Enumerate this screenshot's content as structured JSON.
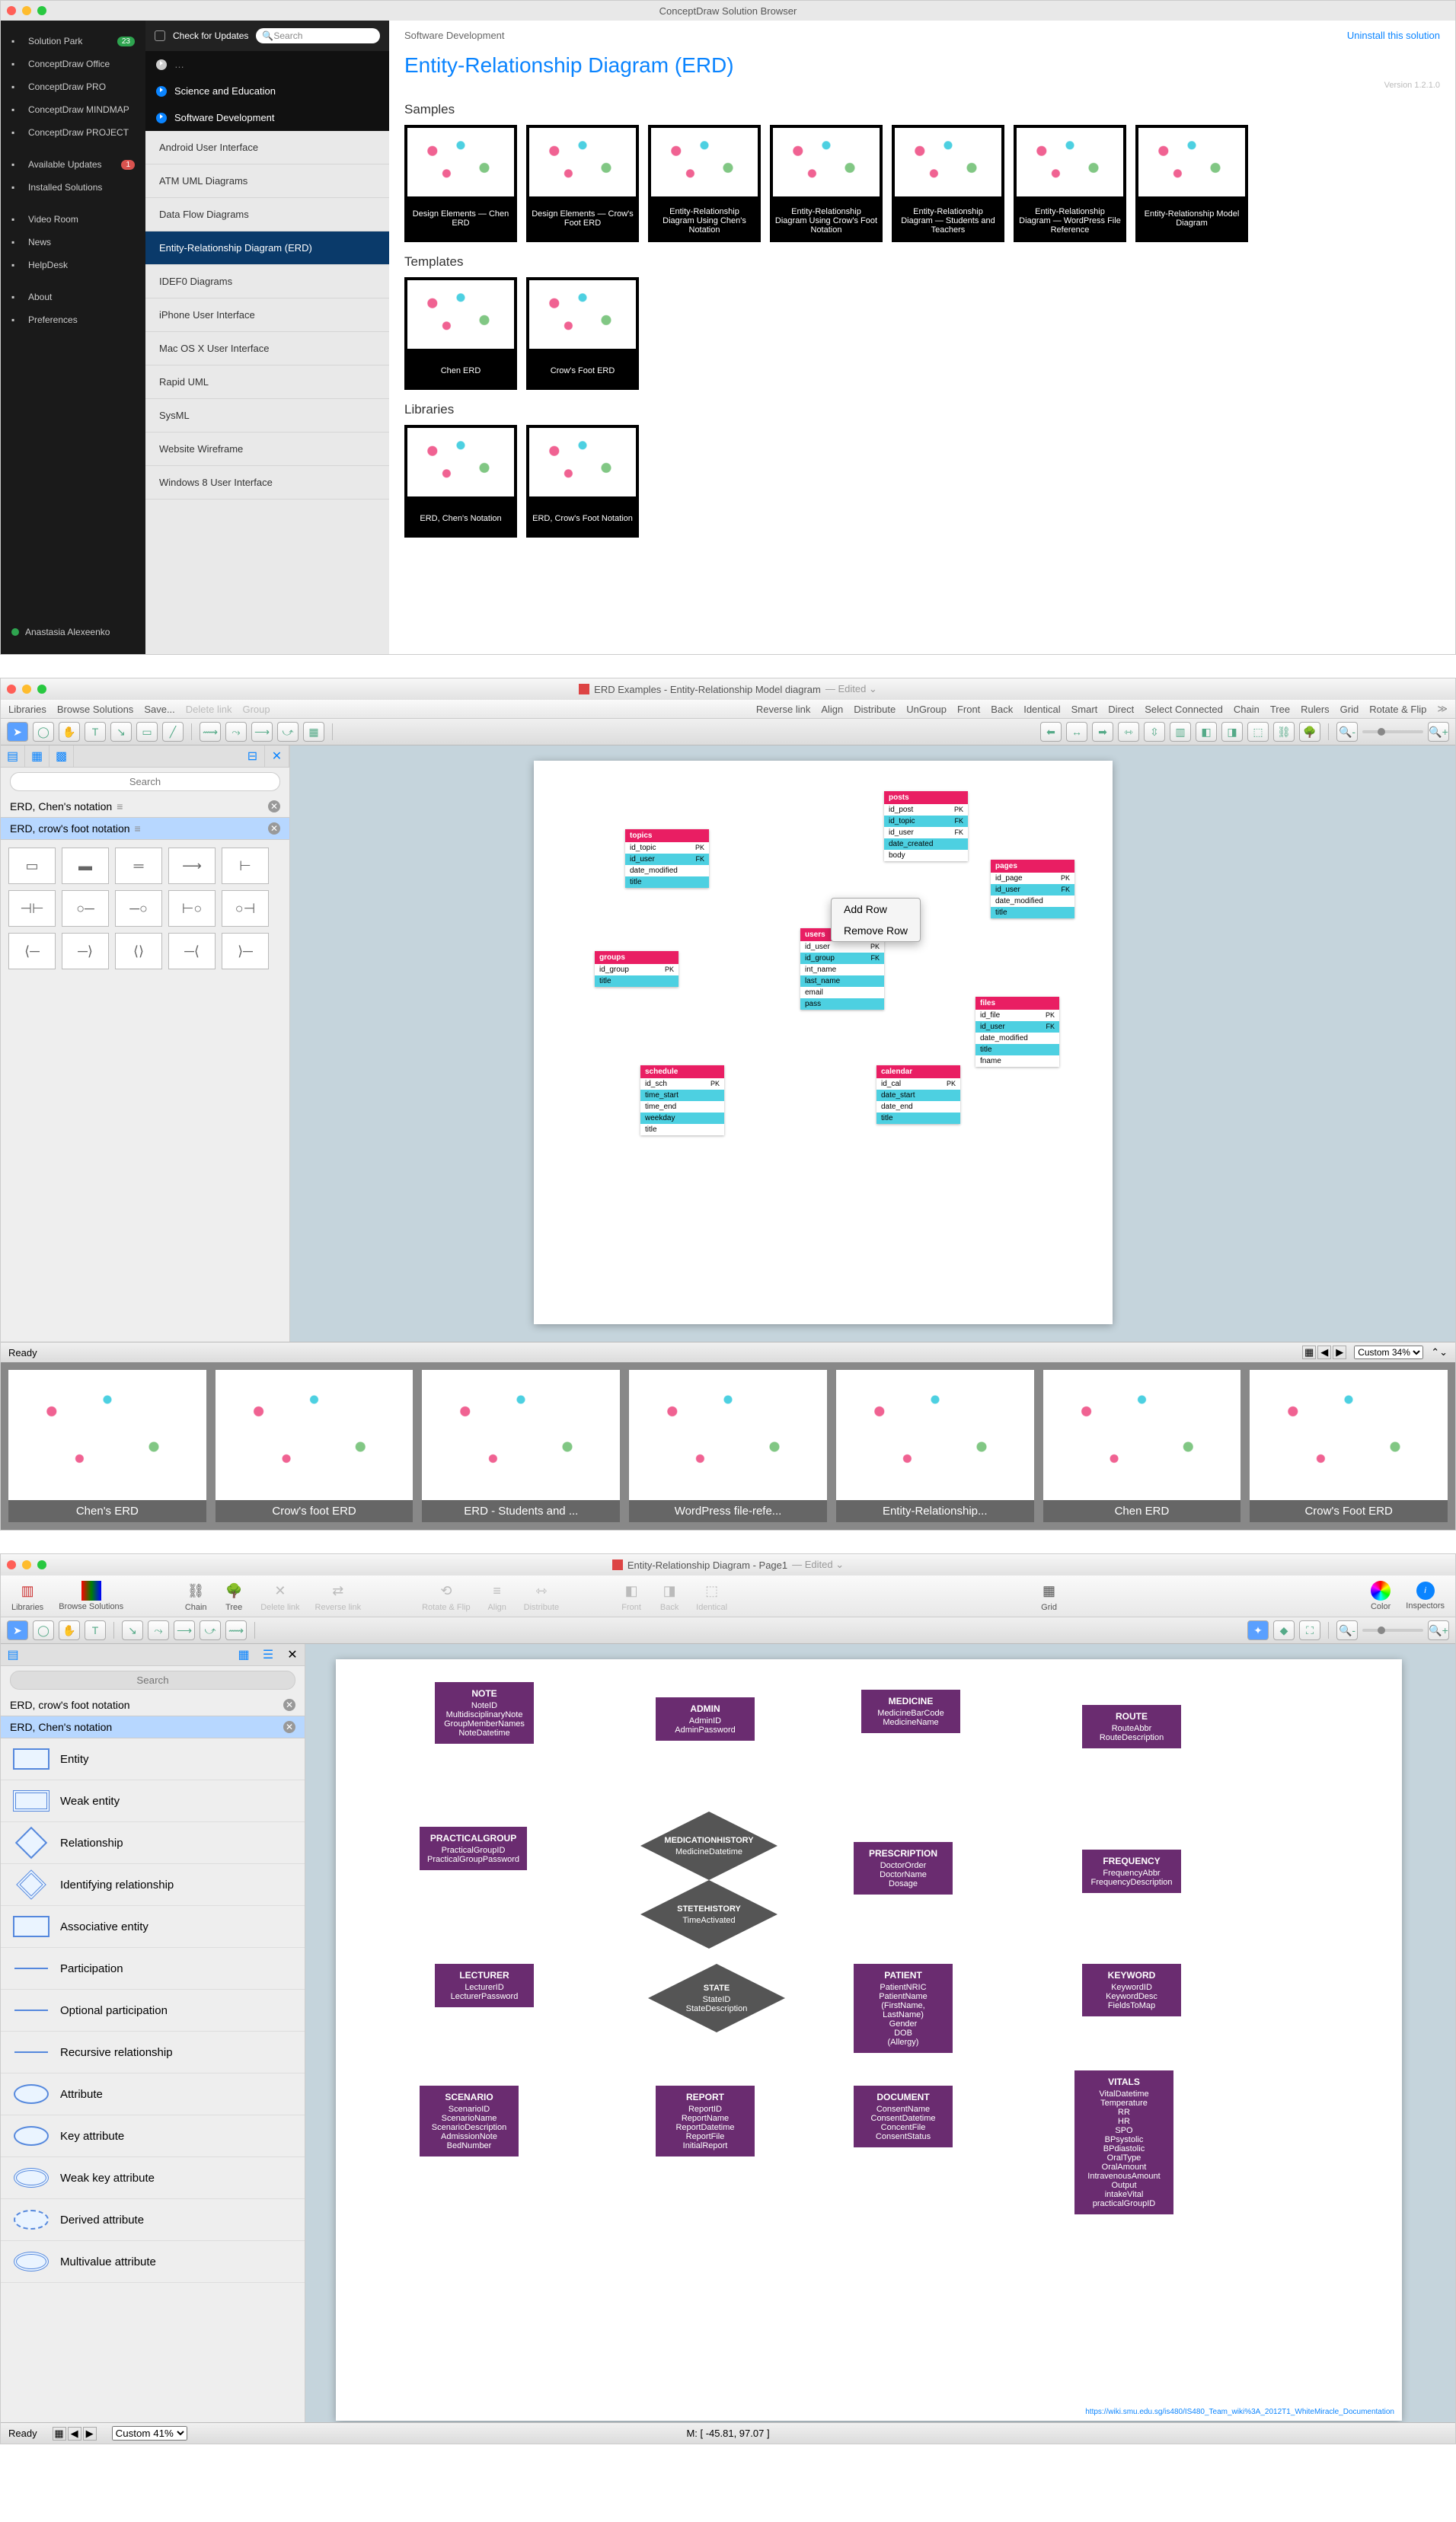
{
  "sb": {
    "windowTitle": "ConceptDraw Solution Browser",
    "leftNav": {
      "items": [
        {
          "label": "Solution Park",
          "badge": "23",
          "badgeColor": "green"
        },
        {
          "label": "ConceptDraw Office"
        },
        {
          "label": "ConceptDraw PRO"
        },
        {
          "label": "ConceptDraw MINDMAP"
        },
        {
          "label": "ConceptDraw PROJECT"
        }
      ],
      "items2": [
        {
          "label": "Available Updates",
          "badge": "1",
          "badgeColor": "red"
        },
        {
          "label": "Installed Solutions"
        }
      ],
      "items3": [
        {
          "label": "Video Room"
        },
        {
          "label": "News"
        },
        {
          "label": "HelpDesk"
        }
      ],
      "items4": [
        {
          "label": "About"
        },
        {
          "label": "Preferences"
        }
      ],
      "user": "Anastasia Alexeenko"
    },
    "catPanel": {
      "checkUpdates": "Check for Updates",
      "searchPlaceholder": "Search",
      "cats": [
        "Science and Education",
        "Software Development"
      ],
      "subs": [
        "Android User Interface",
        "ATM UML Diagrams",
        "Data Flow Diagrams",
        "Entity-Relationship Diagram (ERD)",
        "IDEF0 Diagrams",
        "iPhone User Interface",
        "Mac OS X User Interface",
        "Rapid UML",
        "SysML",
        "Website Wireframe",
        "Windows 8 User Interface"
      ],
      "activeIndex": 3
    },
    "main": {
      "breadcrumb": "Software Development",
      "uninstall": "Uninstall this solution",
      "title": "Entity-Relationship Diagram (ERD)",
      "version": "Version 1.2.1.0",
      "sections": {
        "samples": "Samples",
        "templates": "Templates",
        "libraries": "Libraries"
      },
      "samples": [
        "Design Elements — Chen ERD",
        "Design Elements — Crow's Foot ERD",
        "Entity-Relationship Diagram Using Chen's Notation",
        "Entity-Relationship Diagram Using Crow's Foot Notation",
        "Entity-Relationship Diagram — Students and Teachers",
        "Entity-Relationship Diagram — WordPress File Reference",
        "Entity-Relationship Model Diagram"
      ],
      "templates": [
        "Chen ERD",
        "Crow's Foot ERD"
      ],
      "libraries": [
        "ERD, Chen's Notation",
        "ERD, Crow's Foot Notation"
      ]
    }
  },
  "ed": {
    "title": "ERD Examples - Entity-Relationship Model diagram",
    "edited": "— Edited ⌄",
    "toolbar1": [
      "Libraries",
      "Browse Solutions",
      "Save...",
      "Delete link",
      "Group",
      "Reverse link",
      "Align",
      "Distribute",
      "UnGroup",
      "Front",
      "Back",
      "Identical",
      "Smart",
      "Direct",
      "Select Connected",
      "Chain",
      "Tree",
      "Rulers",
      "Grid",
      "Rotate & Flip"
    ],
    "searchPlaceholder": "Search",
    "libs": [
      "ERD, Chen's notation",
      "ERD, crow's foot notation"
    ],
    "activeLib": 1,
    "contextMenu": [
      "Add Row",
      "Remove Row"
    ],
    "entities": {
      "posts": {
        "title": "posts",
        "fields": [
          [
            "id_post",
            "PK"
          ],
          [
            "id_topic",
            "FK"
          ],
          [
            "id_user",
            "FK"
          ],
          [
            "date_created",
            ""
          ],
          [
            "body",
            ""
          ]
        ]
      },
      "topics": {
        "title": "topics",
        "fields": [
          [
            "id_topic",
            "PK"
          ],
          [
            "id_user",
            "FK"
          ],
          [
            "date_modified",
            ""
          ],
          [
            "title",
            ""
          ]
        ]
      },
      "pages": {
        "title": "pages",
        "fields": [
          [
            "id_page",
            "PK"
          ],
          [
            "id_user",
            "FK"
          ],
          [
            "date_modified",
            ""
          ],
          [
            "title",
            ""
          ]
        ]
      },
      "groups": {
        "title": "groups",
        "fields": [
          [
            "id_group",
            "PK"
          ],
          [
            "title",
            ""
          ]
        ]
      },
      "users": {
        "title": "users",
        "fields": [
          [
            "id_user",
            "PK"
          ],
          [
            "id_group",
            "FK"
          ],
          [
            "int_name",
            ""
          ],
          [
            "last_name",
            ""
          ],
          [
            "email",
            ""
          ],
          [
            "pass",
            ""
          ]
        ]
      },
      "files": {
        "title": "files",
        "fields": [
          [
            "id_file",
            "PK"
          ],
          [
            "id_user",
            "FK"
          ],
          [
            "date_modified",
            ""
          ],
          [
            "title",
            ""
          ],
          [
            "fname",
            ""
          ]
        ]
      },
      "schedule": {
        "title": "schedule",
        "fields": [
          [
            "id_sch",
            "PK"
          ],
          [
            "time_start",
            ""
          ],
          [
            "time_end",
            ""
          ],
          [
            "weekday",
            ""
          ],
          [
            "title",
            ""
          ]
        ]
      },
      "calendar": {
        "title": "calendar",
        "fields": [
          [
            "id_cal",
            "PK"
          ],
          [
            "date_start",
            ""
          ],
          [
            "date_end",
            ""
          ],
          [
            "title",
            ""
          ]
        ]
      }
    },
    "status": {
      "ready": "Ready",
      "zoom": "Custom 34%"
    },
    "thumbs": [
      "Chen's ERD",
      "Crow's foot ERD",
      "ERD - Students and ...",
      "WordPress file-refe...",
      "Entity-Relationship...",
      "Chen ERD",
      "Crow's Foot ERD"
    ]
  },
  "ed3": {
    "title": "Entity-Relationship Diagram - Page1",
    "edited": "— Edited ⌄",
    "toolbar": [
      "Libraries",
      "Browse Solutions",
      "Chain",
      "Tree",
      "Delete link",
      "Reverse link",
      "Rotate & Flip",
      "Align",
      "Distribute",
      "Front",
      "Back",
      "Identical",
      "Grid",
      "Color",
      "Inspectors"
    ],
    "searchPlaceholder": "Search",
    "libs": [
      "ERD, crow's foot notation",
      "ERD, Chen's notation"
    ],
    "activeLib": 1,
    "stencils": [
      "Entity",
      "Weak entity",
      "Relationship",
      "Identifying relationship",
      "Associative entity",
      "Participation",
      "Optional participation",
      "Recursive relationship",
      "Attribute",
      "Key attribute",
      "Weak key attribute",
      "Derived attribute",
      "Multivalue attribute"
    ],
    "entities": {
      "note": {
        "t": "NOTE",
        "f": [
          "NoteID",
          "MultidisciplinaryNote",
          "GroupMemberNames",
          "NoteDatetime"
        ]
      },
      "admin": {
        "t": "ADMIN",
        "f": [
          "AdminID",
          "AdminPassword"
        ]
      },
      "medicine": {
        "t": "MEDICINE",
        "f": [
          "MedicineBarCode",
          "MedicineName"
        ]
      },
      "route": {
        "t": "ROUTE",
        "f": [
          "RouteAbbr",
          "RouteDescription"
        ]
      },
      "practicalgroup": {
        "t": "PRACTICALGROUP",
        "f": [
          "PracticalGroupID",
          "PracticalGroupPassword"
        ]
      },
      "medhist": {
        "t": "MEDICATIONHISTORY",
        "f": [
          "MedicineDatetime"
        ]
      },
      "statehist": {
        "t": "STETEHISTORY",
        "f": [
          "TimeActivated"
        ]
      },
      "prescription": {
        "t": "PRESCRIPTION",
        "f": [
          "DoctorOrder",
          "DoctorName",
          "Dosage"
        ]
      },
      "frequency": {
        "t": "FREQUENCY",
        "f": [
          "FrequencyAbbr",
          "FrequencyDescription"
        ]
      },
      "lecturer": {
        "t": "LECTURER",
        "f": [
          "LecturerID",
          "LecturerPassword"
        ]
      },
      "state": {
        "t": "STATE",
        "f": [
          "StateID",
          "StateDescription"
        ]
      },
      "patient": {
        "t": "PATIENT",
        "f": [
          "PatientNRIC",
          "PatientName",
          "(FirstName,",
          "LastName)",
          "Gender",
          "DOB",
          "(Allergy)"
        ]
      },
      "keyword": {
        "t": "KEYWORD",
        "f": [
          "KeywordID",
          "KeywordDesc",
          "FieldsToMap"
        ]
      },
      "scenario": {
        "t": "SCENARIO",
        "f": [
          "ScenarioID",
          "ScenarioName",
          "ScenarioDescription",
          "AdmissionNote",
          "BedNumber"
        ]
      },
      "report": {
        "t": "REPORT",
        "f": [
          "ReportID",
          "ReportName",
          "ReportDatetime",
          "ReportFile",
          "InitialReport"
        ]
      },
      "document": {
        "t": "DOCUMENT",
        "f": [
          "ConsentName",
          "ConsentDatetime",
          "ConcentFile",
          "ConsentStatus"
        ]
      },
      "vitals": {
        "t": "VITALS",
        "f": [
          "VitalDatetime",
          "Temperature",
          "RR",
          "HR",
          "SPO",
          "BPsystolic",
          "BPdiastolic",
          "OralType",
          "OralAmount",
          "IntravenousAmount",
          "Output",
          "intakeVital",
          "practicalGroupID"
        ]
      }
    },
    "url": "https://wiki.smu.edu.sg/is480/IS480_Team_wiki%3A_2012T1_WhiteMiracle_Documentation",
    "status": {
      "ready": "Ready",
      "zoom": "Custom 41%",
      "mouse": "M: [ -45.81, 97.07 ]"
    }
  }
}
